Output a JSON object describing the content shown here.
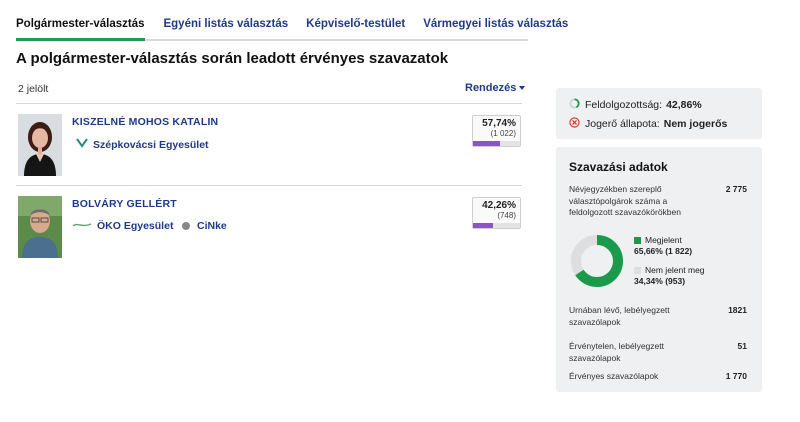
{
  "tabs": [
    {
      "label": "Polgármester-választás",
      "active": true
    },
    {
      "label": "Egyéni listás választás",
      "active": false
    },
    {
      "label": "Képviselő-testület",
      "active": false
    },
    {
      "label": "Vármegyei listás választás",
      "active": false
    }
  ],
  "page": {
    "title": "A polgármester-választás során leadott érvényes szavazatok",
    "count_text": "2 jelölt",
    "sort_label": "Rendezés"
  },
  "candidates": [
    {
      "name": "KISZELNÉ MOHOS KATALIN",
      "orgs": [
        {
          "name": "Szépkovácsi Egyesület",
          "icon": "org-logo-icon"
        }
      ],
      "percent_text": "57,74%",
      "votes_text": "(1 022)",
      "percent": 57.74
    },
    {
      "name": "BOLVÁRY GELLÉRT",
      "orgs": [
        {
          "name": "ÖKO Egyesület",
          "icon": "eko-logo-icon"
        },
        {
          "name": "CiNke",
          "icon": "grey-dot-icon"
        }
      ],
      "percent_text": "42,26%",
      "votes_text": "(748)",
      "percent": 42.26
    }
  ],
  "status": {
    "processed_label": "Feldolgozottság:",
    "processed_value": "42,86%",
    "legal_label": "Jogerő állapota:",
    "legal_value": "Nem jogerős"
  },
  "stats": {
    "title": "Szavazási adatok",
    "registered_label": "Névjegyzékben szereplő választópolgárok száma a feldolgozott szavazókörökben",
    "registered_value": "2 775",
    "appeared_label": "Megjelent",
    "appeared_value": "65,66% (1 822)",
    "appeared_percent": 65.66,
    "not_appeared_label": "Nem jelent meg",
    "not_appeared_value": "34,34% (953)",
    "ballots_in_urn_label": "Urnában lévő, lebélyegzett szavazólapok",
    "ballots_in_urn_value": "1821",
    "invalid_label": "Érvénytelen, lebélyegzett szavazólapok",
    "invalid_value": "51",
    "valid_label": "Érvényes szavazólapok",
    "valid_value": "1 770"
  },
  "colors": {
    "tab_active_underline": "#1e9d4a",
    "link_blue": "#1f3a8a",
    "bar_purple": "#8a55c9",
    "donut_green": "#1a9a4a",
    "donut_grey": "#dcdedf",
    "error_red": "#d93025"
  }
}
